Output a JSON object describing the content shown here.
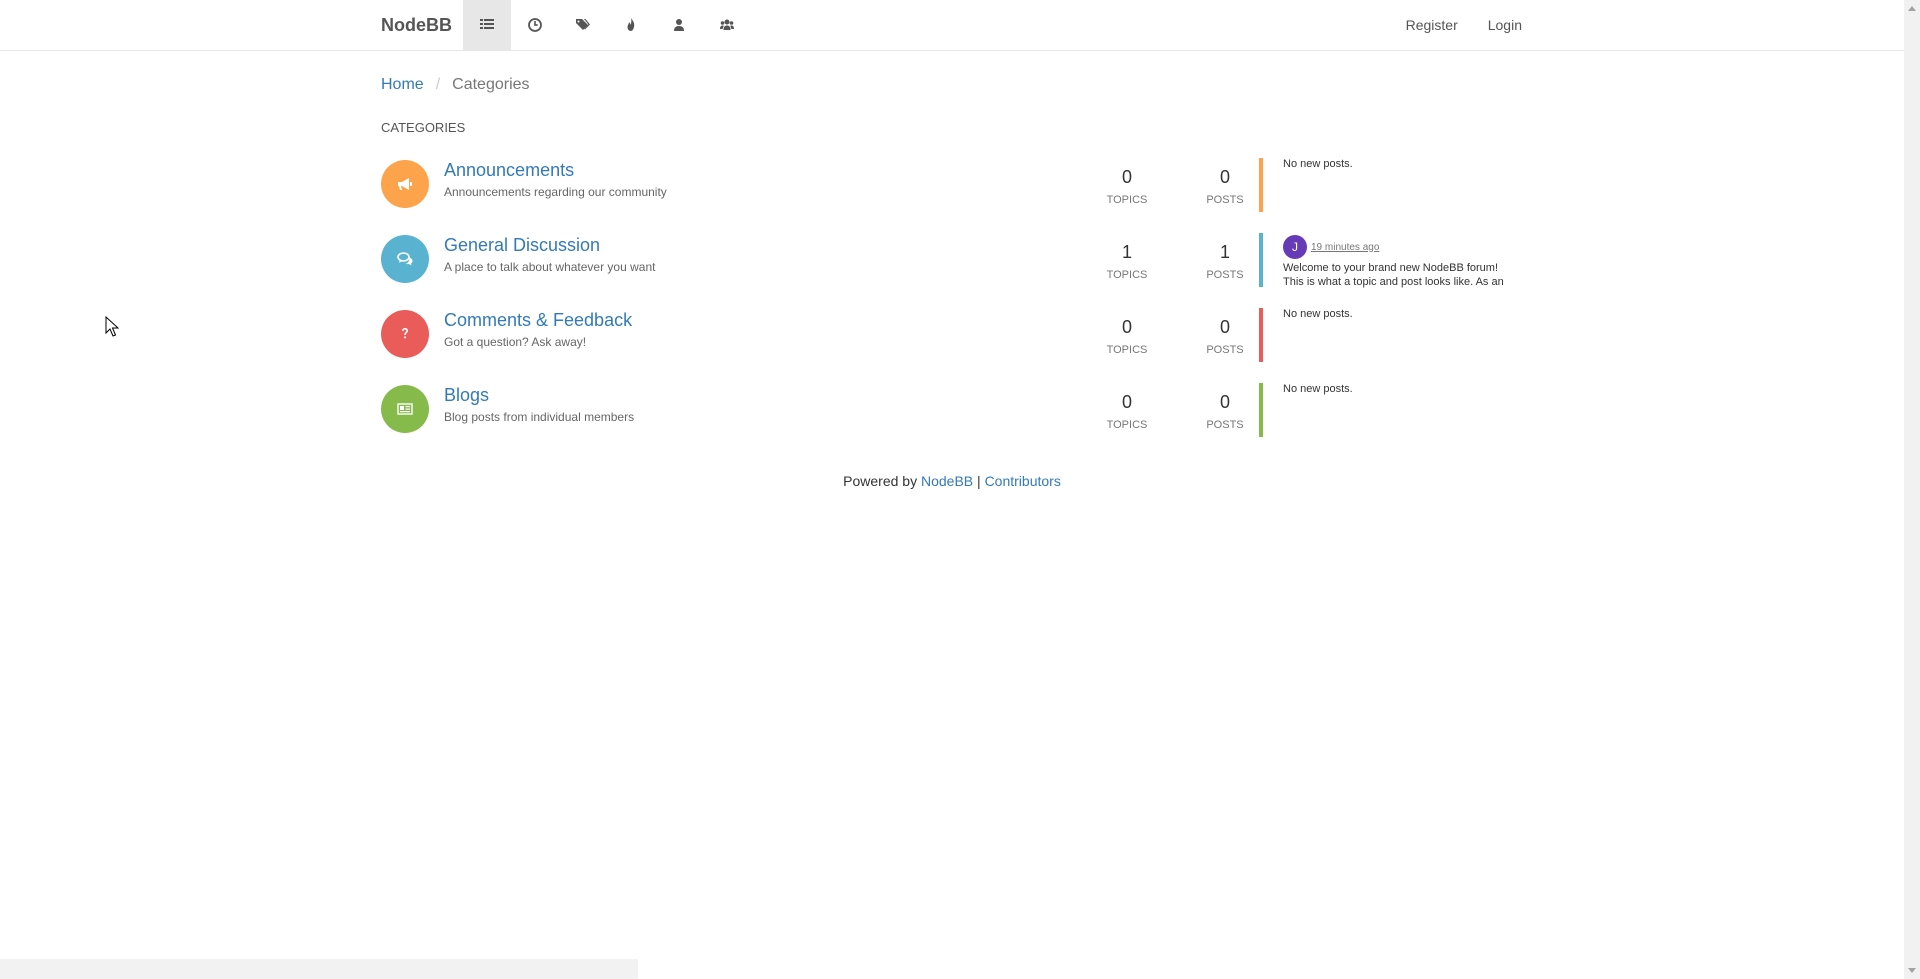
{
  "navbar": {
    "brand": "NodeBB",
    "icons": [
      "categories-icon",
      "recent-icon",
      "tags-icon",
      "popular-icon",
      "users-icon",
      "groups-icon"
    ],
    "register": "Register",
    "login": "Login"
  },
  "breadcrumb": {
    "home": "Home",
    "separator": "/",
    "current": "Categories"
  },
  "section_title": "CATEGORIES",
  "categories": [
    {
      "title": "Announcements",
      "description": "Announcements regarding our community",
      "color": "#fda34b",
      "icon": "bullhorn-icon",
      "topics": "0",
      "topics_label": "TOPICS",
      "posts": "0",
      "posts_label": "POSTS",
      "teaser": "No new posts."
    },
    {
      "title": "General Discussion",
      "description": "A place to talk about whatever you want",
      "color": "#59b3d0",
      "icon": "comments-icon",
      "topics": "1",
      "topics_label": "TOPICS",
      "posts": "1",
      "posts_label": "POSTS",
      "teaser_avatar": "J",
      "teaser_avatar_color": "#673ab7",
      "teaser_time": "19 minutes ago",
      "teaser_line1": "Welcome to your brand new NodeBB forum!",
      "teaser_line2": "This is what a topic and post looks like. As an"
    },
    {
      "title": "Comments & Feedback",
      "description": "Got a question? Ask away!",
      "color": "#e95c5a",
      "icon": "question-icon",
      "topics": "0",
      "topics_label": "TOPICS",
      "posts": "0",
      "posts_label": "POSTS",
      "teaser": "No new posts."
    },
    {
      "title": "Blogs",
      "description": "Blog posts from individual members",
      "color": "#86ba4b",
      "icon": "newspaper-icon",
      "topics": "0",
      "topics_label": "TOPICS",
      "posts": "0",
      "posts_label": "POSTS",
      "teaser": "No new posts."
    }
  ],
  "footer": {
    "powered_by": "Powered by",
    "nodebb": "NodeBB",
    "separator": "|",
    "contributors": "Contributors"
  }
}
